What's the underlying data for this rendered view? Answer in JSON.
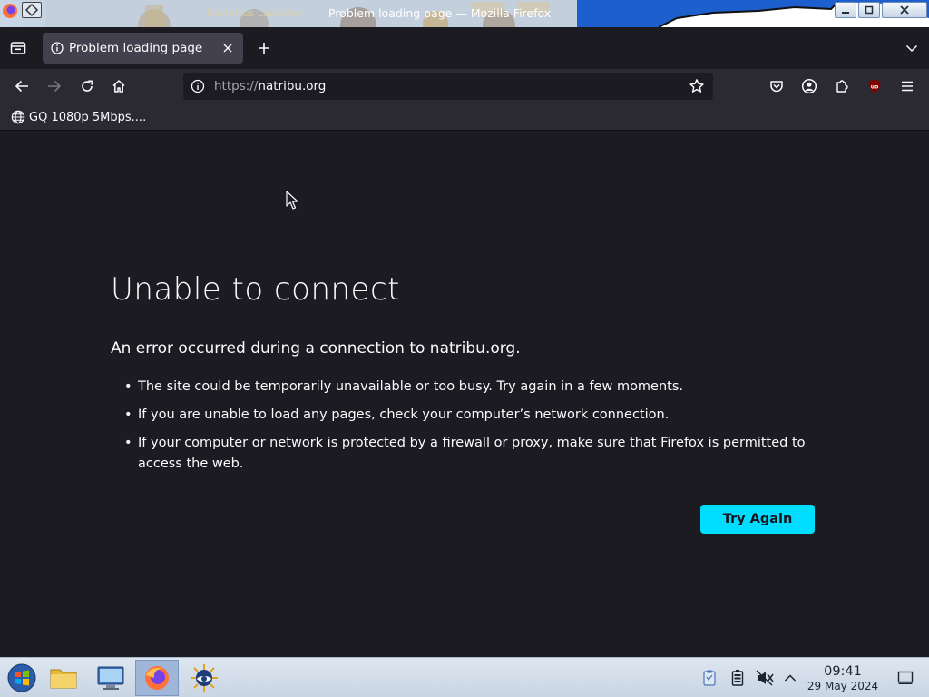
{
  "window": {
    "title": "Problem loading page — Mozilla Firefox",
    "background_window_title": "KevinPlus Launcher"
  },
  "tabs": [
    {
      "label": "Problem loading page",
      "active": true,
      "icon": "info-icon"
    }
  ],
  "toolbar": {
    "url_scheme": "https://",
    "url_host": "natribu.org"
  },
  "bookmarks": [
    {
      "label": "GQ 1080p 5Mbps....",
      "icon": "globe-icon"
    }
  ],
  "error": {
    "title": "Unable to connect",
    "short_desc": "An error occurred during a connection to natribu.org.",
    "items": [
      "The site could be temporarily unavailable or too busy. Try again in a few moments.",
      "If you are unable to load any pages, check your computer’s network connection.",
      "If your computer or network is protected by a firewall or proxy, make sure that Firefox is permitted to access the web."
    ],
    "button_label": "Try Again"
  },
  "taskbar": {
    "items": [
      "start-menu-icon",
      "file-manager-icon",
      "system-settings-icon",
      "firefox-icon",
      "kde-app-icon"
    ],
    "active_item": "firefox-icon",
    "tray": [
      "clipboard-icon",
      "battery-icon",
      "volume-muted-icon",
      "show-hidden-icon"
    ],
    "clock_time": "09:41",
    "clock_date": "29 May 2024"
  },
  "colors": {
    "page_bg": "#1c1b22",
    "toolbar_bg": "#2b2a33",
    "tab_active_bg": "#42414d",
    "accent_button": "#00ddff",
    "text_primary": "#fbfbfe"
  }
}
